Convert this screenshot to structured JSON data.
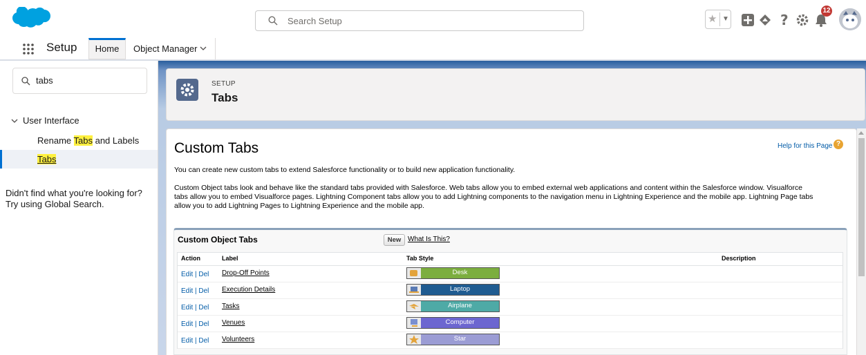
{
  "header": {
    "search_placeholder": "Search Setup",
    "notification_count": "12",
    "icons": [
      "salesforce-cloud-logo",
      "star-icon",
      "add-icon",
      "trailhead-icon",
      "help-icon",
      "gear-icon",
      "bell-icon",
      "avatar"
    ]
  },
  "nav": {
    "app_name": "Setup",
    "tabs": [
      {
        "label": "Home"
      },
      {
        "label": "Object Manager"
      }
    ]
  },
  "sidebar": {
    "quick_find_value": "tabs",
    "tree_heading": "User Interface",
    "items": [
      {
        "pre": "Rename ",
        "highlight": "Tabs",
        "post": " and Labels"
      },
      {
        "pre": "",
        "highlight": "Tabs",
        "post": ""
      }
    ],
    "not_found_line1": "Didn't find what you're looking for?",
    "not_found_line2": "Try using Global Search."
  },
  "page_header": {
    "subtitle": "SETUP",
    "title": "Tabs"
  },
  "content": {
    "heading": "Custom Tabs",
    "help_link": "Help for this Page",
    "intro": "You can create new custom tabs to extend Salesforce functionality or to build new application functionality.",
    "desc_line1": "Custom Object tabs look and behave like the standard tabs provided with Salesforce. Web tabs allow you to embed external web applications and content within the Salesforce window. Visualforce",
    "desc_line2": "tabs allow you to embed Visualforce pages. Lightning Component tabs allow you to add Lightning components to the navigation menu in Lightning Experience and the mobile app. Lightning Page tabs",
    "desc_line3": "allow you to add Lightning Pages to Lightning Experience and the mobile app."
  },
  "custom_object_tabs": {
    "title": "Custom Object Tabs",
    "new_button": "New",
    "what_is_this": "What Is This?",
    "columns": [
      "Action",
      "Label",
      "Tab Style",
      "Description"
    ],
    "action_text": "Edit | Del",
    "rows": [
      {
        "label": "Drop-Off Points",
        "style": "Desk",
        "color": "#7cae3f"
      },
      {
        "label": "Execution Details",
        "style": "Laptop",
        "color": "#1f5c91"
      },
      {
        "label": "Tasks",
        "style": "Airplane",
        "color": "#4eaaa6"
      },
      {
        "label": "Venues",
        "style": "Computer",
        "color": "#6c66d0"
      },
      {
        "label": "Volunteers",
        "style": "Star",
        "color": "#9b9cd4"
      }
    ]
  }
}
